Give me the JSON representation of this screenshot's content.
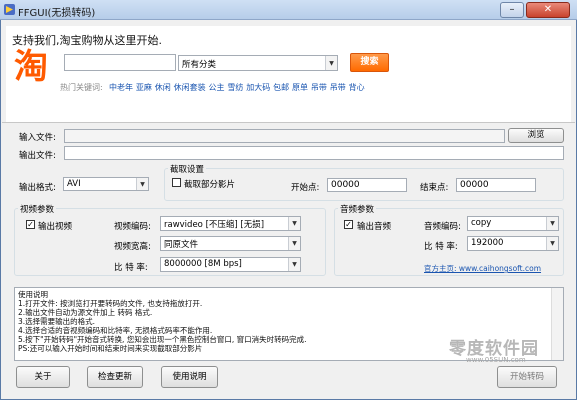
{
  "window": {
    "title": "FFGUI(无损转码)"
  },
  "ad": {
    "heading": "支持我们,淘宝购物从这里开始.",
    "logo_text": "淘",
    "search_value": "",
    "category_value": "所有分类",
    "search_button": "搜索",
    "hot_label": "热门关键词:",
    "hot_keywords": [
      "中老年",
      "亚麻",
      "休闲",
      "休闲套装",
      "公主",
      "雪纺",
      "加大码",
      "包邮",
      "原单",
      "吊带",
      "吊带",
      "背心"
    ]
  },
  "files": {
    "input_label": "输入文件:",
    "input_value": "",
    "browse_button": "浏览",
    "output_label": "输出文件:",
    "output_value": ""
  },
  "format": {
    "label": "输出格式:",
    "value": "AVI"
  },
  "cut": {
    "group_title": "截取设置",
    "checkbox_label": "截取部分影片",
    "checked": false,
    "start_label": "开始点:",
    "start_value": "00000",
    "end_label": "结束点:",
    "end_value": "00000"
  },
  "video": {
    "group_title": "视频参数",
    "output_label": "输出视频",
    "checked": true,
    "codec_label": "视频编码:",
    "codec_value": "rawvideo [不压缩]  [无损]",
    "size_label": "视频宽高:",
    "size_value": "同原文件",
    "bitrate_label": "比 特 率:",
    "bitrate_value": "8000000     [8M bps]"
  },
  "audio": {
    "group_title": "音频参数",
    "output_label": "输出音频",
    "checked": true,
    "codec_label": "音频编码:",
    "codec_value": "copy",
    "bitrate_label": "比 特 率:",
    "bitrate_value": "192000",
    "homepage_link": "官方主页: www.caihongsoft.com"
  },
  "log": {
    "lines": [
      "使用说明",
      "1.打开文件: 按浏览打开要转码的文件, 也支持拖放打开.",
      "2.输出文件自动为源文件加上 转码 格式.",
      "3.选择需要输出的格式.",
      "4.选择合适的音视频编码和比特率, 无损格式码率不能作用.",
      "5.按下\"开始转码\"开始音式转换, 您知会出现一个黑色控制台窗口, 窗口消失时转码完成.",
      "PS:还可以输入开始时间和结束时间来实现截取部分影片"
    ]
  },
  "buttons": {
    "about": "关于",
    "update": "检查更新",
    "help": "使用说明",
    "start": "开始转码"
  },
  "watermark": {
    "text": "零度软件园",
    "url": "www.05SUN.com"
  }
}
